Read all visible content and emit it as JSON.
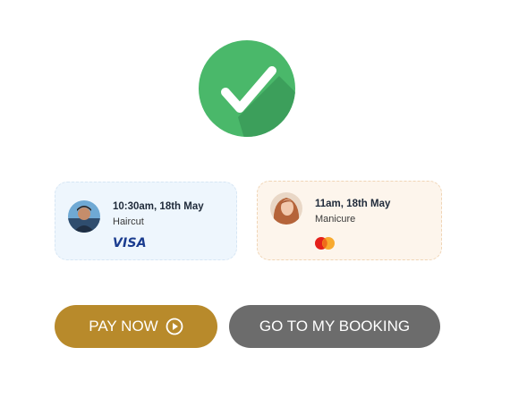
{
  "status": {
    "icon": "check-icon",
    "color": "#4ab86a"
  },
  "bookings": [
    {
      "time": "10:30am, 18th May",
      "service": "Haircut",
      "payment_label": "VISA",
      "payment_icon": "visa-logo"
    },
    {
      "time": "11am, 18th May",
      "service": "Manicure",
      "payment_icon": "mastercard-logo"
    }
  ],
  "actions": {
    "pay_now_label": "PAY NOW",
    "pay_now_icon": "play-circle-icon",
    "pay_now_color": "#b88a2b",
    "go_to_booking_label": "GO TO MY BOOKING",
    "go_to_booking_color": "#6c6c6c"
  }
}
